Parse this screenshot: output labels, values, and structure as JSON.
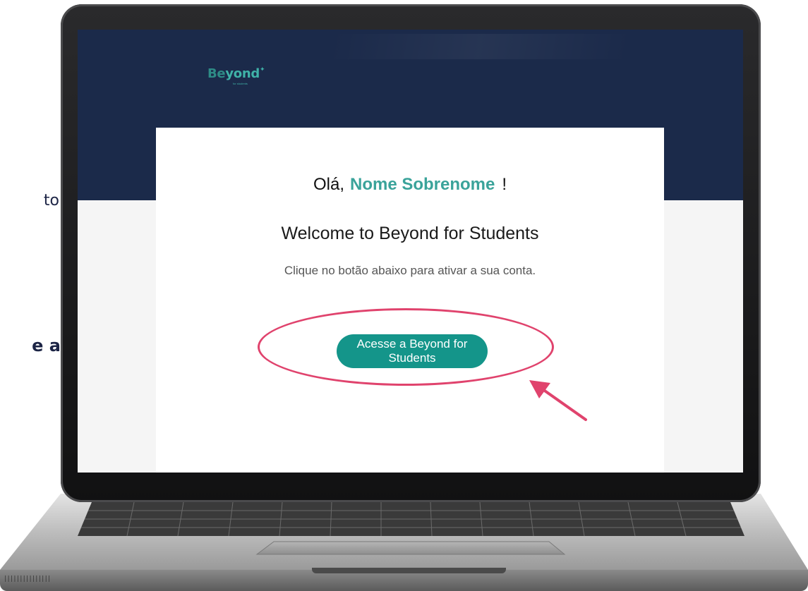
{
  "side_text": {
    "fragment_1": "to",
    "fragment_2": "e a"
  },
  "email": {
    "logo": {
      "brand_b": "Be",
      "brand_rest": "yond",
      "tagline": "for students"
    },
    "greeting_prefix": "Olá,",
    "greeting_name": "Nome Sobrenome",
    "greeting_suffix": "!",
    "welcome_title": "Welcome to Beyond for Students",
    "instruction": "Clique no botão abaixo para ativar a sua conta.",
    "cta_label": "Acesse a Beyond for Students"
  },
  "colors": {
    "header_bg": "#1b2a4a",
    "accent_teal": "#14958a",
    "name_teal": "#3aa39a",
    "highlight_pink": "#e0436d"
  },
  "laptop": {
    "grille": "|||||||||||||||"
  }
}
